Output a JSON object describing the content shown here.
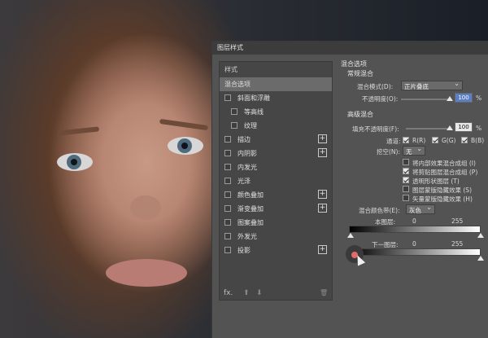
{
  "dialog": {
    "title": "图层样式"
  },
  "left_panel": {
    "header": "样式",
    "items": [
      {
        "label": "混合选项",
        "selected": true,
        "checkbox": false,
        "plus": false,
        "sub": false
      },
      {
        "label": "斜面和浮雕",
        "selected": false,
        "checkbox": true,
        "plus": false,
        "sub": false
      },
      {
        "label": "等高线",
        "selected": false,
        "checkbox": true,
        "plus": false,
        "sub": true
      },
      {
        "label": "纹理",
        "selected": false,
        "checkbox": true,
        "plus": false,
        "sub": true
      },
      {
        "label": "描边",
        "selected": false,
        "checkbox": true,
        "plus": true,
        "sub": false
      },
      {
        "label": "内阴影",
        "selected": false,
        "checkbox": true,
        "plus": true,
        "sub": false
      },
      {
        "label": "内发光",
        "selected": false,
        "checkbox": true,
        "plus": false,
        "sub": false
      },
      {
        "label": "光泽",
        "selected": false,
        "checkbox": true,
        "plus": false,
        "sub": false
      },
      {
        "label": "颜色叠加",
        "selected": false,
        "checkbox": true,
        "plus": true,
        "sub": false
      },
      {
        "label": "渐变叠加",
        "selected": false,
        "checkbox": true,
        "plus": true,
        "sub": false
      },
      {
        "label": "图案叠加",
        "selected": false,
        "checkbox": true,
        "plus": false,
        "sub": false
      },
      {
        "label": "外发光",
        "selected": false,
        "checkbox": true,
        "plus": false,
        "sub": false
      },
      {
        "label": "投影",
        "selected": false,
        "checkbox": true,
        "plus": true,
        "sub": false
      }
    ],
    "footer": {
      "fx": "fx.",
      "up": "⬆",
      "down": "⬇",
      "trash": "🗑"
    }
  },
  "blend_options": {
    "title": "混合选项",
    "general": {
      "title": "常规混合",
      "mode_label": "混合模式(D):",
      "mode_value": "正片叠底",
      "opacity_label": "不透明度(O):",
      "opacity_value": "100",
      "opacity_unit": "%"
    },
    "advanced": {
      "title": "高级混合",
      "fill_label": "填充不透明度(F):",
      "fill_value": "100",
      "fill_unit": "%",
      "channels_label": "通道:",
      "channel_r": "R(R)",
      "channel_g": "G(G)",
      "channel_b": "B(B)",
      "knockout_label": "挖空(N):",
      "knockout_value": "无",
      "options": [
        {
          "label": "将内部效果混合成组 (I)",
          "checked": false
        },
        {
          "label": "将剪贴图层混合成组 (P)",
          "checked": true
        },
        {
          "label": "透明形状图层 (T)",
          "checked": true
        },
        {
          "label": "图层蒙版隐藏效果 (S)",
          "checked": false
        },
        {
          "label": "矢量蒙版隐藏效果 (H)",
          "checked": false
        }
      ]
    },
    "blend_if": {
      "label": "混合颜色带(E):",
      "value": "灰色",
      "this_layer_label": "本图层:",
      "this_min": "0",
      "this_max": "255",
      "under_layer_label": "下一图层:",
      "under_min": "0",
      "under_max": "255"
    }
  }
}
